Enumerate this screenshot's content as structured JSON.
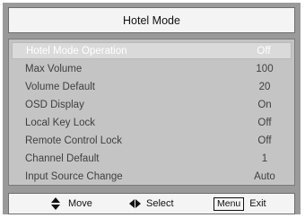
{
  "header": {
    "title": "Hotel Mode"
  },
  "menu": {
    "selected_index": 0,
    "items": [
      {
        "label": "Hotel Mode Operation",
        "value": "Off"
      },
      {
        "label": "Max Volume",
        "value": "100"
      },
      {
        "label": "Volume Default",
        "value": "20"
      },
      {
        "label": "OSD Display",
        "value": "On"
      },
      {
        "label": "Local Key Lock",
        "value": "Off"
      },
      {
        "label": "Remote Control Lock",
        "value": "Off"
      },
      {
        "label": "Channel Default",
        "value": "1"
      },
      {
        "label": "Input Source Change",
        "value": "Auto"
      }
    ]
  },
  "footer": {
    "move_label": "Move",
    "select_label": "Select",
    "menu_key": "Menu",
    "exit_label": "Exit",
    "icons": {
      "move": "up-down-arrows-icon",
      "select": "left-right-arrows-icon"
    }
  },
  "colors": {
    "frame": "#9a9a9a",
    "panel": "#c4c4c4",
    "selected_row": "#dadada",
    "bar": "#f4f4f4"
  }
}
